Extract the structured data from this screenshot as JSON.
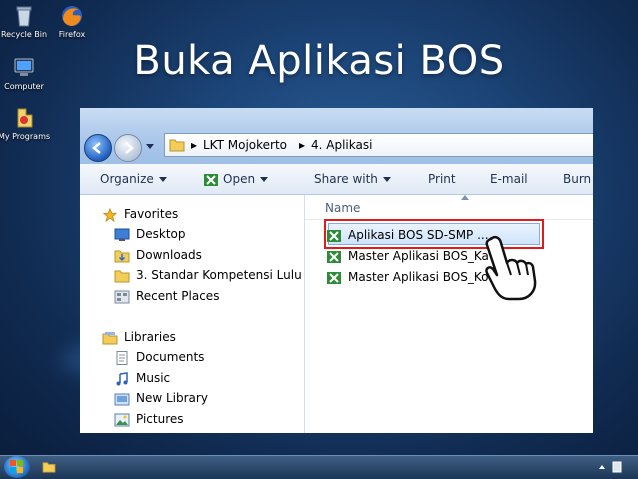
{
  "slide_title": "Buka Aplikasi BOS",
  "desktop_icons": [
    {
      "label": "Recycle Bin",
      "icon": "recycle-bin-icon"
    },
    {
      "label": "Firefox",
      "icon": "firefox-icon"
    },
    {
      "label": "Computer",
      "icon": "computer-icon"
    },
    {
      "label": "My Programs",
      "icon": "programs-icon"
    }
  ],
  "explorer": {
    "breadcrumb": [
      "LKT Mojokerto",
      "4. Aplikasi"
    ],
    "toolbar": [
      "Organize",
      "Open",
      "Share with",
      "Print",
      "E-mail",
      "Burn"
    ],
    "favorites_label": "Favorites",
    "favorites": [
      "Desktop",
      "Downloads",
      "3. Standar Kompetensi Lulu",
      "Recent Places"
    ],
    "libraries_label": "Libraries",
    "libraries": [
      "Documents",
      "Music",
      "New Library",
      "Pictures"
    ],
    "column_header": "Name",
    "files": [
      "Aplikasi BOS SD-SMP ......",
      "Master Aplikasi BOS_Ka",
      "Master Aplikasi BOS_Ko"
    ]
  },
  "colors": {
    "highlight": "#e01b1b",
    "selection": "#cfe4fb"
  }
}
